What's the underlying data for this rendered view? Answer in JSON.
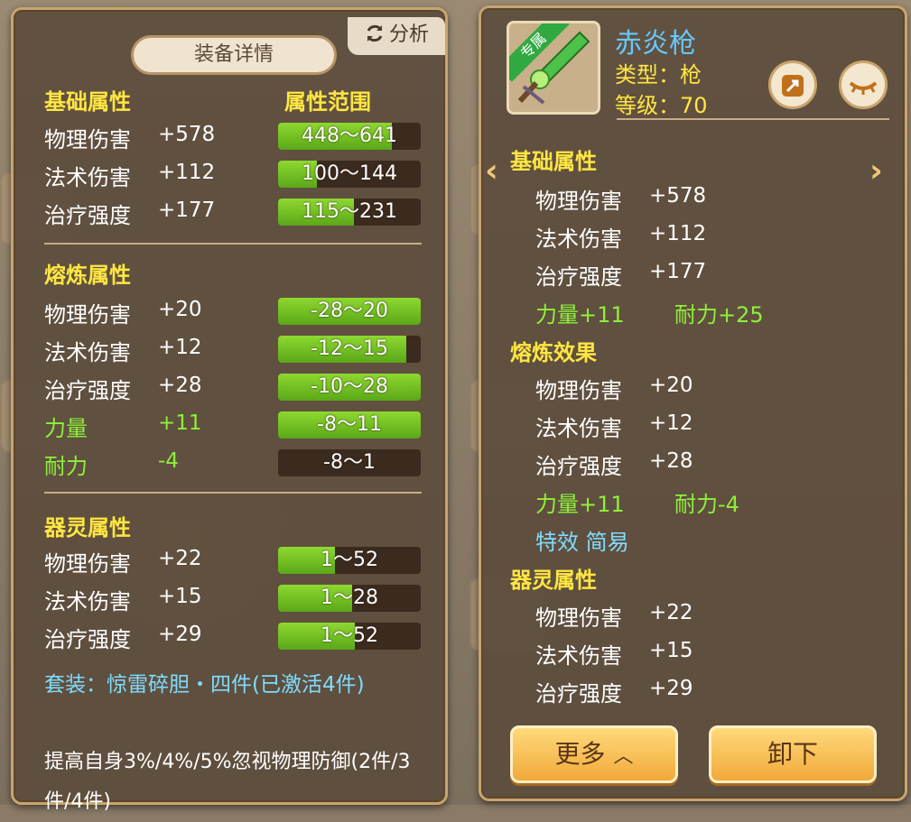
{
  "left": {
    "title": "装备详情",
    "analyze_label": "分析",
    "base_header": "基础属性",
    "range_header": "属性范围",
    "base_rows": [
      {
        "label": "物理伤害",
        "value": "+578",
        "range": "448～641",
        "fill": 0.8
      },
      {
        "label": "法术伤害",
        "value": "+112",
        "range": "100～144",
        "fill": 0.27
      },
      {
        "label": "治疗强度",
        "value": "+177",
        "range": "115～231",
        "fill": 0.53
      }
    ],
    "smelt_header": "熔炼属性",
    "smelt_rows": [
      {
        "label": "物理伤害",
        "value": "+20",
        "range": "-28～20",
        "fill": 1.0,
        "green": false
      },
      {
        "label": "法术伤害",
        "value": "+12",
        "range": "-12～15",
        "fill": 0.9,
        "green": false
      },
      {
        "label": "治疗强度",
        "value": "+28",
        "range": "-10～28",
        "fill": 1.0,
        "green": false
      },
      {
        "label": "力量",
        "value": "+11",
        "range": "-8～11",
        "fill": 1.0,
        "green": true
      },
      {
        "label": "耐力",
        "value": "-4",
        "range": "-8～1",
        "fill": 0.0,
        "green": true
      }
    ],
    "spirit_header": "器灵属性",
    "spirit_rows": [
      {
        "label": "物理伤害",
        "value": "+22",
        "range": "1～52",
        "fill": 0.4
      },
      {
        "label": "法术伤害",
        "value": "+15",
        "range": "1～28",
        "fill": 0.52
      },
      {
        "label": "治疗强度",
        "value": "+29",
        "range": "1～52",
        "fill": 0.54
      }
    ],
    "suit": "套装：惊雷碎胆・四件(已激活4件)",
    "desc": "提高自身3%/4%/5%忽视物理防御(2件/3件/4件)"
  },
  "right": {
    "badge": "专属",
    "name": "赤炎枪",
    "type": "类型：枪",
    "level": "等级：70",
    "base_header": "基础属性",
    "base_rows": [
      {
        "label": "物理伤害",
        "value": "+578"
      },
      {
        "label": "法术伤害",
        "value": "+112"
      },
      {
        "label": "治疗强度",
        "value": "+177"
      }
    ],
    "base_extra_1": "力量+11",
    "base_extra_2": "耐力+25",
    "smelt_header": "熔炼效果",
    "smelt_rows": [
      {
        "label": "物理伤害",
        "value": "+20"
      },
      {
        "label": "法术伤害",
        "value": "+12"
      },
      {
        "label": "治疗强度",
        "value": "+28"
      }
    ],
    "smelt_extra_1": "力量+11",
    "smelt_extra_2": "耐力-4",
    "special": "特效 简易",
    "spirit_header": "器灵属性",
    "spirit_rows": [
      {
        "label": "物理伤害",
        "value": "+22"
      },
      {
        "label": "法术伤害",
        "value": "+15"
      },
      {
        "label": "治疗强度",
        "value": "+29"
      }
    ],
    "more_label": "更多",
    "unequip_label": "卸下"
  },
  "colors": {
    "yellow": "#ffe642",
    "green": "#8ef03a",
    "cyan": "#7fdcff",
    "blue_name": "#65c8ff"
  }
}
